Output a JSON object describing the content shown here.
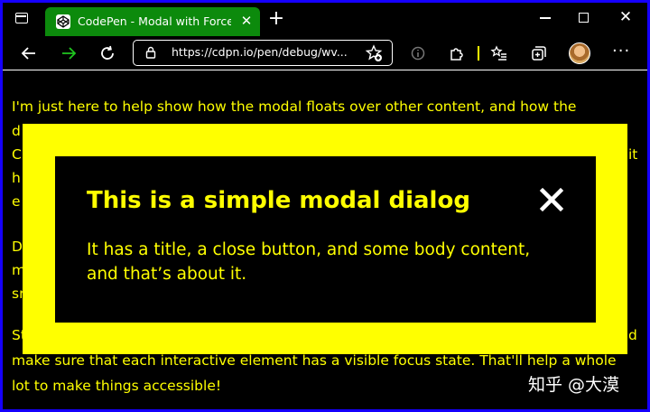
{
  "browser": {
    "tab": {
      "title": "CodePen - Modal with Forced Co",
      "close_glyph": "✕"
    },
    "new_tab_glyph": "+",
    "window": {
      "close_glyph": "✕"
    },
    "address_bar": {
      "url": "https://cdpn.io/pen/debug/wv..."
    },
    "more_glyph": "···",
    "icons": [
      "tab-actions-icon",
      "codepen-icon",
      "back-icon",
      "forward-icon",
      "refresh-icon",
      "lock-icon",
      "favorites-add-icon",
      "info-icon",
      "extensions-icon",
      "favorites-icon",
      "collections-icon",
      "avatar",
      "more-icon"
    ],
    "accent_color": "#0c8a0c"
  },
  "page": {
    "paragraphs": [
      "I'm just here to help show how the modal floats over other content, and how the",
      "D",
      "St"
    ],
    "visible_fragments_left": [
      "d",
      "C",
      "h",
      "e",
      "m",
      "sr"
    ],
    "visible_fragment_right": "it",
    "right_fragment_bottom": "d",
    "lines_below_modal": [
      "make sure that each interactive element has a visible focus state. That'll help a whole",
      "lot to make things accessible!"
    ],
    "text_color": "#ffff00",
    "background_color": "#000000"
  },
  "modal": {
    "title": "This is a simple modal dialog",
    "body": "It has a title, a close button, and some body content, and that’s about it.",
    "close_glyph": "✕",
    "frame_color": "#ffff00"
  },
  "watermark": {
    "text": "知乎 @大漠"
  }
}
